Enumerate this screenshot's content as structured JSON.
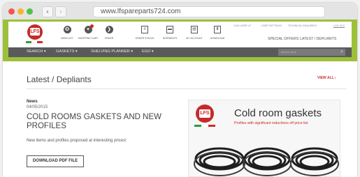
{
  "browser": {
    "url": "www.lfspareparts724.com",
    "back_glyph": "‹",
    "forward_glyph": "›"
  },
  "header": {
    "logo_text": "LFS",
    "flag_colors": [
      "#2a9d3a",
      "#ffffff",
      "#d62828"
    ],
    "quick_icons": [
      {
        "label": "WISH LIST",
        "icon": "star-icon",
        "glyph": "✪"
      },
      {
        "label": "SHOPPING CART",
        "icon": "cart-icon",
        "glyph": "▾"
      },
      {
        "label": "ORDER",
        "icon": "order-icon",
        "glyph": "❯"
      },
      {
        "label": "ORDER STATUS",
        "icon": "clipboard-icon",
        "glyph": "≡"
      },
      {
        "label": "SHIPMENTS",
        "icon": "truck-icon",
        "glyph": "▬"
      },
      {
        "label": "MY ACCOUNT",
        "icon": "account-icon",
        "glyph": "▤"
      },
      {
        "label": "DOWNLOAD",
        "icon": "download-icon",
        "glyph": "⬇"
      }
    ],
    "top_links": [
      "CIAO USER LF",
      "USER SETTINGS",
      "TECHNICAL ENQUIRIES",
      "LOG OUT"
    ],
    "special_offers": "SPECIAL OFFERS",
    "latest_depliants": "LATEST / DEPLIANTS"
  },
  "menu": {
    "items": [
      "SEARCH ▾",
      "GASKETS ▾",
      "SHELVING PLANNER ▾",
      "EGO ▾"
    ],
    "search_placeholder": "search store",
    "search_icon": "⌕"
  },
  "main": {
    "section_title": "Latest / Depliants",
    "view_all": "VIEW ALL ›",
    "article": {
      "category": "News",
      "date": "04/05/2015",
      "title": "COLD ROOMS GASKETS AND NEW PROFILES",
      "excerpt": "New items and profiles proposed at interesting prices!",
      "button": "DOWNLOAD PDF FILE"
    },
    "promo": {
      "logo_text": "LFS",
      "title": "Cold room gaskets",
      "subtitle": "Profiles with significant reductions off price list"
    }
  },
  "colors": {
    "accent_green": "#9dc03a",
    "menu_gray": "#5a5a5a",
    "brand_red": "#c62a2a"
  }
}
